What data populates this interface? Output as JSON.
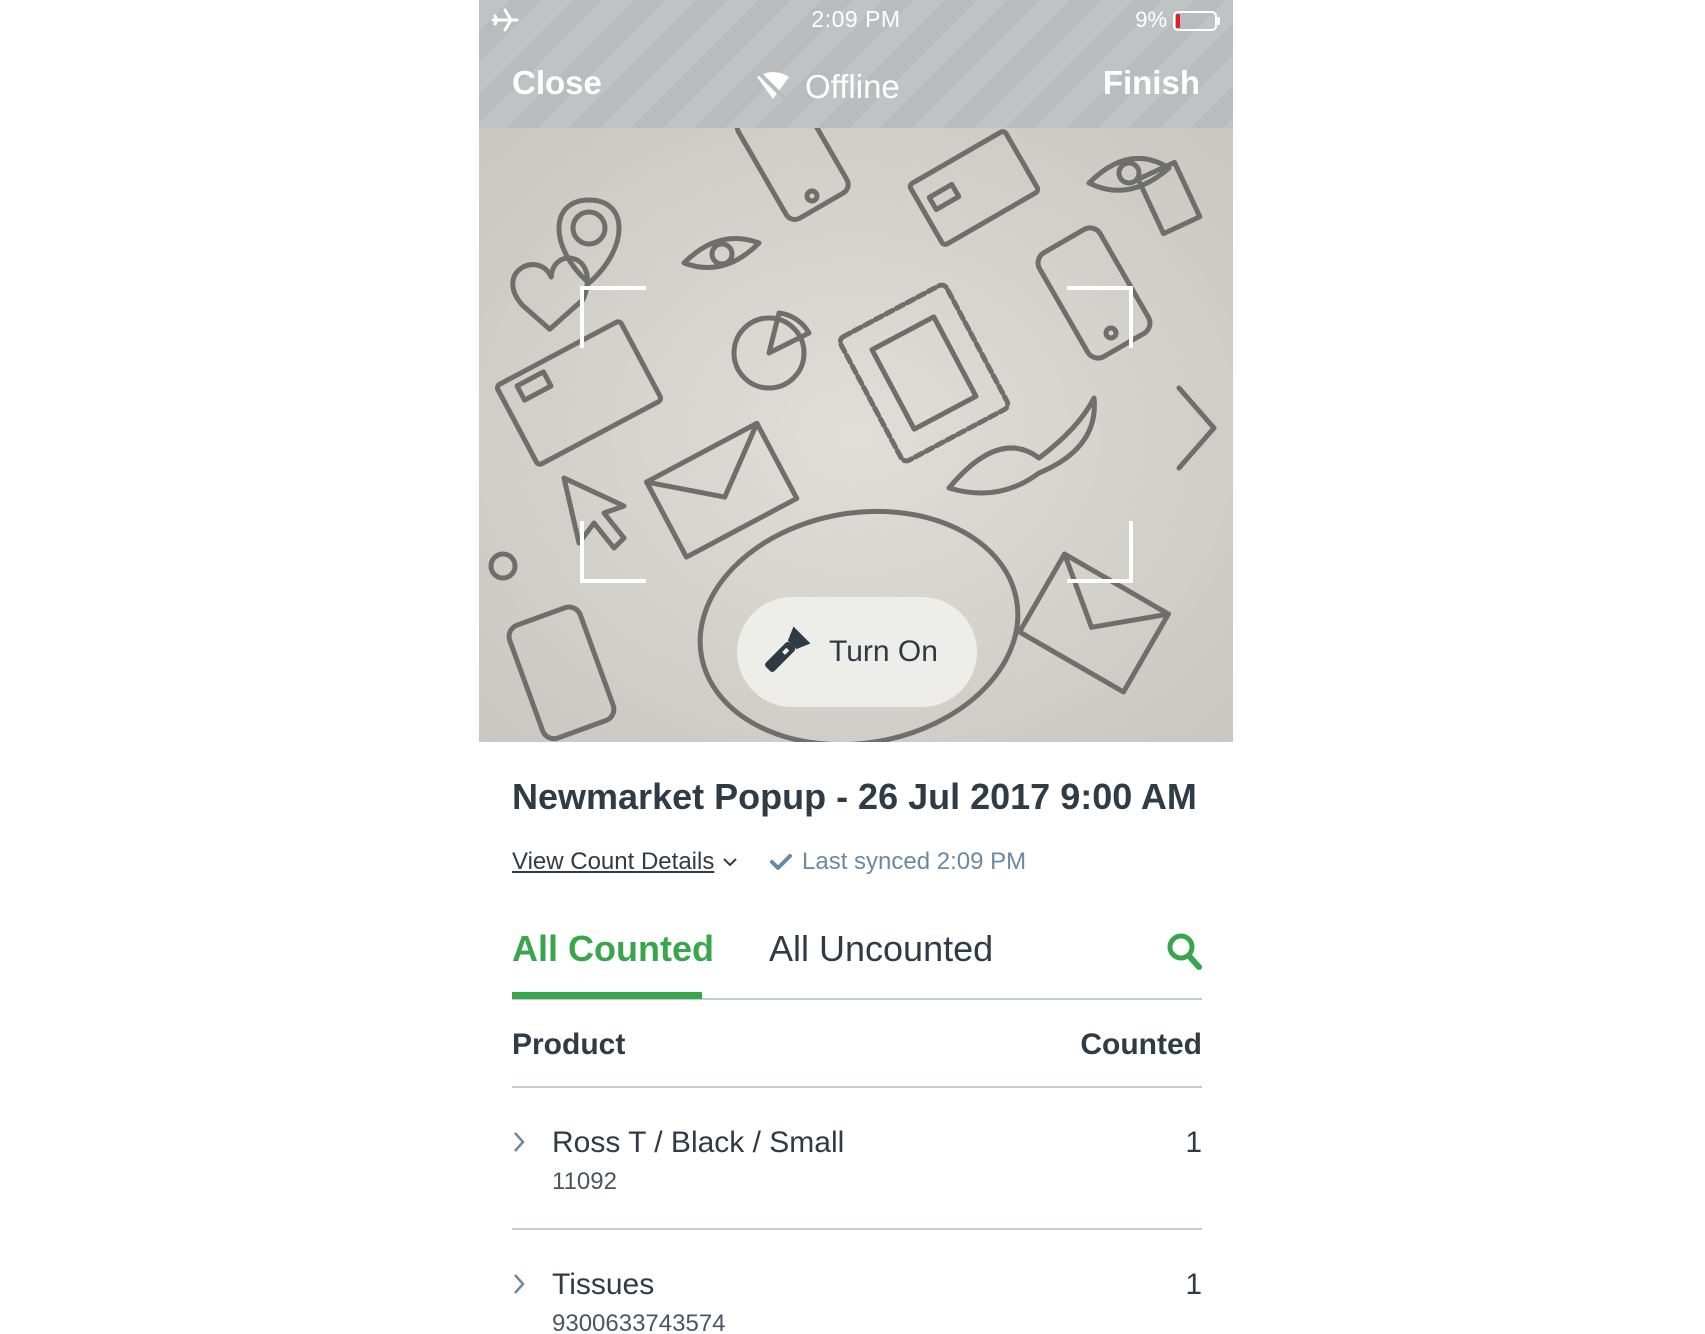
{
  "status_bar": {
    "time": "2:09 PM",
    "battery_percent": "9%",
    "battery_level": 0.09,
    "icons": [
      "airplane-icon",
      "battery-icon"
    ]
  },
  "nav": {
    "close_label": "Close",
    "offline_label": "Offline",
    "finish_label": "Finish",
    "icons": [
      "wifi-off-icon"
    ]
  },
  "scanner": {
    "torch_label": "Turn On",
    "icons": [
      "flashlight-icon"
    ]
  },
  "count": {
    "title": "Newmarket Popup - 26 Jul 2017 9:00 AM",
    "view_details_label": "View Count Details",
    "synced_label": "Last synced 2:09 PM"
  },
  "tabs": {
    "counted_label": "All Counted",
    "uncounted_label": "All Uncounted",
    "active": "All Counted"
  },
  "table": {
    "headers": {
      "product": "Product",
      "counted": "Counted"
    },
    "rows": [
      {
        "name": "Ross T / Black / Small",
        "sku": "11092",
        "counted": "1"
      },
      {
        "name": "Tissues",
        "sku": "9300633743574",
        "counted": "1"
      }
    ]
  },
  "colors": {
    "accent_green": "#3aa64c",
    "text_dark": "#2f3b45",
    "text_muted": "#6a8aa3",
    "topbar_gray": "#b9bcbd",
    "battery_low": "#e02020"
  }
}
